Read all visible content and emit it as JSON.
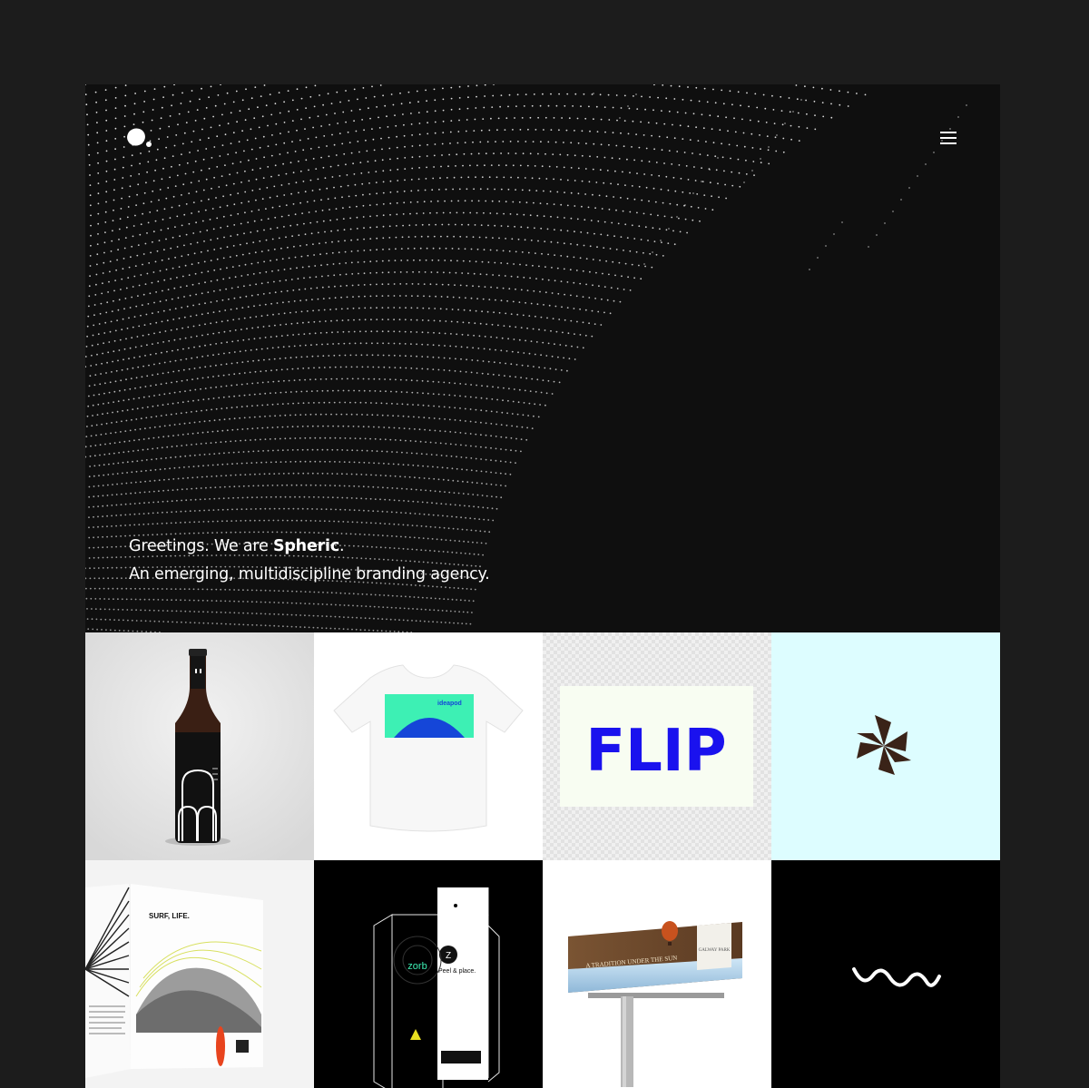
{
  "header": {
    "logo_icon": "spheric-dot-logo-icon",
    "menu_icon": "hamburger-menu-icon"
  },
  "hero": {
    "greeting": "Greetings. We are ",
    "brand": "Spheric",
    "greeting_end": ".",
    "subline": "An emerging, multidiscipline branding agency."
  },
  "portfolio": {
    "tiles": [
      {
        "id": "beer-bottle",
        "bg": "#e6e6e6"
      },
      {
        "id": "ideapod-tshirt",
        "bg": "#ffffff",
        "label": "ideapod"
      },
      {
        "id": "flip-logo",
        "bg": "#ececec",
        "label": "FLIP"
      },
      {
        "id": "star-logo",
        "bg": "#ddfdff"
      },
      {
        "id": "surf-life-magazine",
        "bg": "#f2f2f2",
        "label": "SURF, LIFE."
      },
      {
        "id": "zorb-packaging",
        "bg": "#000000",
        "label": "zorb",
        "sub": "Peel & place."
      },
      {
        "id": "galway-park-billboard",
        "bg": "#ffffff",
        "label": "A TRADITION UNDER THE SUN",
        "sub": "GALWAY PARK"
      },
      {
        "id": "wave-logo",
        "bg": "#000000"
      }
    ]
  },
  "colors": {
    "page_bg": "#1c1c1c",
    "hero_bg": "#0f0f0f",
    "flip_blue": "#1a12ee",
    "ideapod_green": "#3df0b4",
    "ideapod_blue": "#1546d8",
    "star_brown": "#3a2318"
  }
}
